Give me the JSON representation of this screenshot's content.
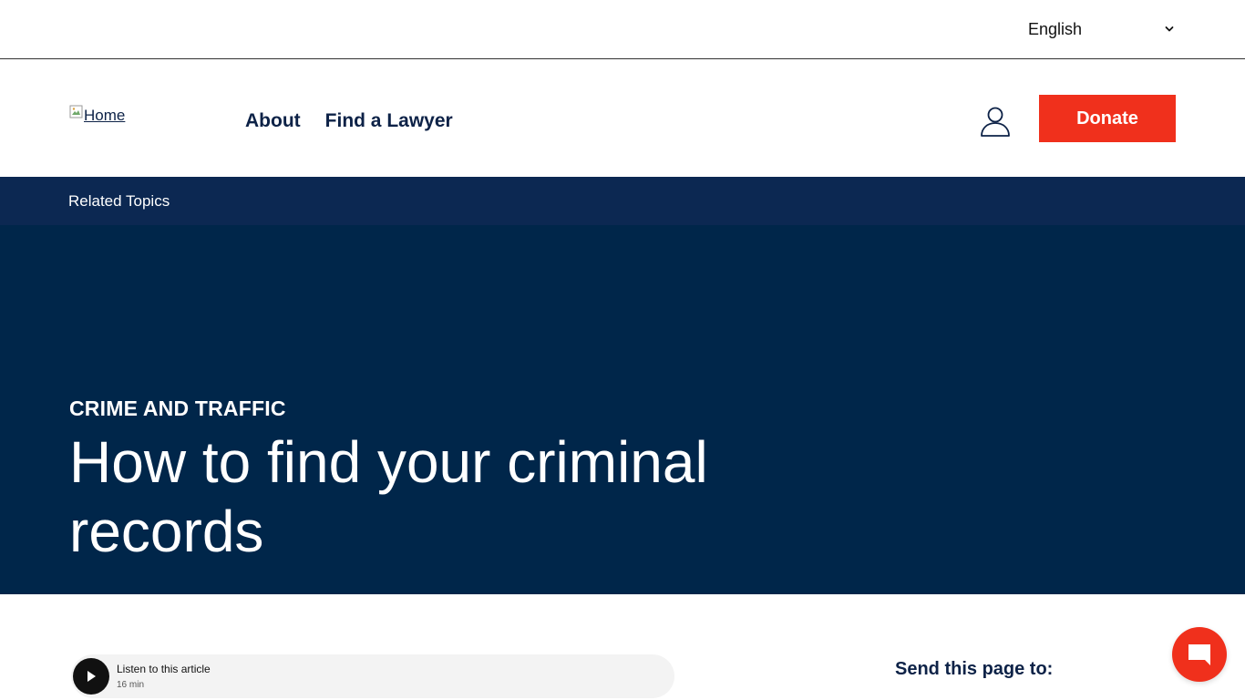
{
  "topbar": {
    "language": {
      "selected": "English",
      "icon": "chevron-down-icon"
    }
  },
  "header": {
    "logo_alt": "Home",
    "nav": [
      {
        "label": "About"
      },
      {
        "label": "Find a Lawyer"
      }
    ],
    "account_icon": "user-icon",
    "donate_label": "Donate"
  },
  "related": {
    "label": "Related Topics"
  },
  "hero": {
    "category": "CRIME AND TRAFFIC",
    "title": "How to find your criminal records"
  },
  "audio": {
    "title": "Listen to this article",
    "duration": "16 min",
    "icon": "play-icon"
  },
  "share": {
    "label": "Send this page to:"
  },
  "chat": {
    "icon": "chat-icon"
  },
  "colors": {
    "accent": "#f0301c",
    "navy": "#00264a",
    "related_bar": "#0c2852",
    "text": "#0d2247"
  }
}
